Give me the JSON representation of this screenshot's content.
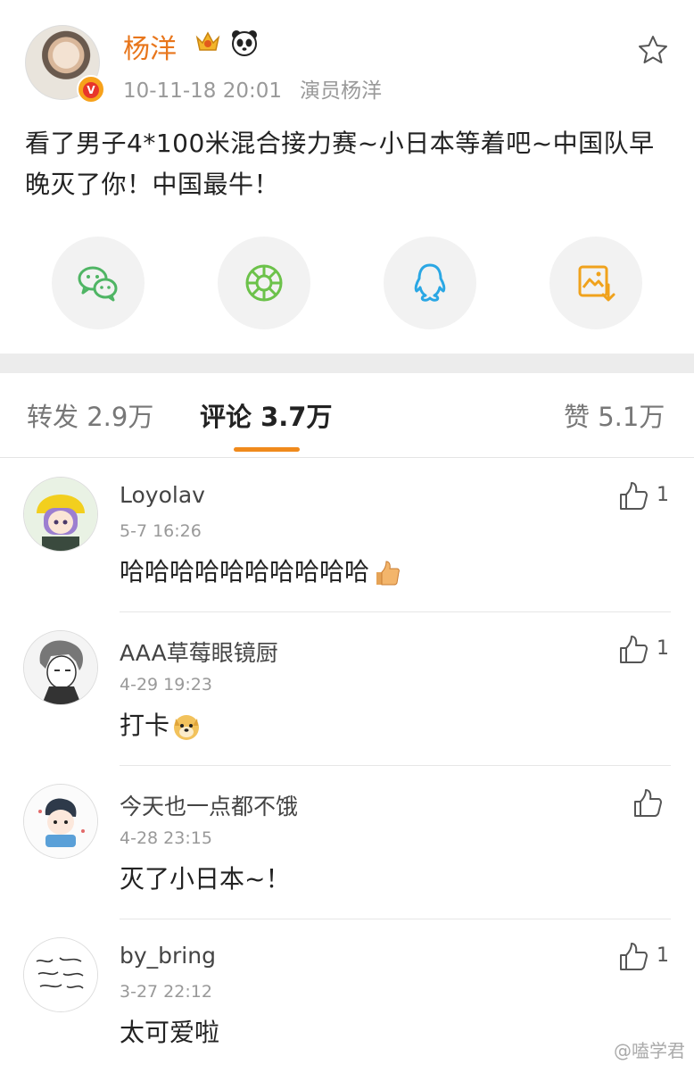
{
  "post": {
    "username": "杨洋",
    "timestamp": "10-11-18 20:01",
    "source": "演员杨洋",
    "text": "看了男子4*100米混合接力赛~小日本等着吧~中国队早晚灭了你！中国最牛！",
    "verified_badge": "V"
  },
  "share": {
    "buttons": [
      "wechat-icon",
      "moments-icon",
      "qq-icon",
      "save-image-icon"
    ]
  },
  "tabs": {
    "repost": "转发 2.9万",
    "comments": "评论 3.7万",
    "likes": "赞 5.1万"
  },
  "comments": [
    {
      "name": "Loyolav",
      "time": "5-7 16:26",
      "text": "哈哈哈哈哈哈哈哈哈哈",
      "emoji": "thumbs-up-emoji",
      "likes": "1"
    },
    {
      "name": "AAA草莓眼镜厨",
      "time": "4-29 19:23",
      "text": "打卡",
      "emoji": "doge-emoji",
      "likes": "1"
    },
    {
      "name": "今天也一点都不饿",
      "time": "4-28 23:15",
      "text": "灭了小日本~！",
      "likes": ""
    },
    {
      "name": "by_bring",
      "time": "3-27 22:12",
      "text": "太可爱啦",
      "likes": "1"
    }
  ],
  "watermark": "@嗑学君",
  "colors": {
    "accent": "#f08a1c",
    "username": "#e8761c",
    "wechat": "#4fb564",
    "moments": "#6cc24a",
    "qq": "#2aa7e4",
    "save": "#f0a21c"
  }
}
